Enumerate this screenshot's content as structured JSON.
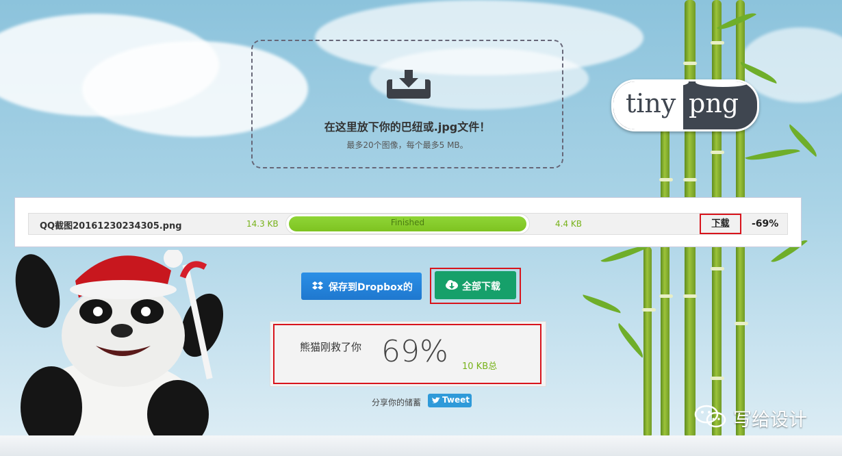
{
  "dropzone": {
    "title": "在这里放下你的巴纽或.jpg文件！",
    "subtitle": "最多20个图像，每个最多5 MB。"
  },
  "logo": {
    "part1": "tiny",
    "part2": "png"
  },
  "file": {
    "name": "QQ截图20161230234305.png",
    "original_size": "14.3 KB",
    "status": "Finished",
    "progress": 1.0,
    "new_size": "4.4 KB",
    "download_label": "下载",
    "reduction": "-69%"
  },
  "buttons": {
    "dropbox_label": "保存到Dropbox的",
    "download_all_label": "全部下载"
  },
  "stats": {
    "label": "熊猫刚救了你",
    "percent": "69%",
    "total": "10 KB总"
  },
  "share": {
    "text": "分享你的储蓄",
    "tweet_label": "Tweet"
  },
  "watermark": {
    "text": "写给设计"
  },
  "colors": {
    "accent_green": "#77b219",
    "dropbox_blue": "#1f78cf",
    "download_green": "#16a06a",
    "highlight_red": "#d8141c"
  }
}
